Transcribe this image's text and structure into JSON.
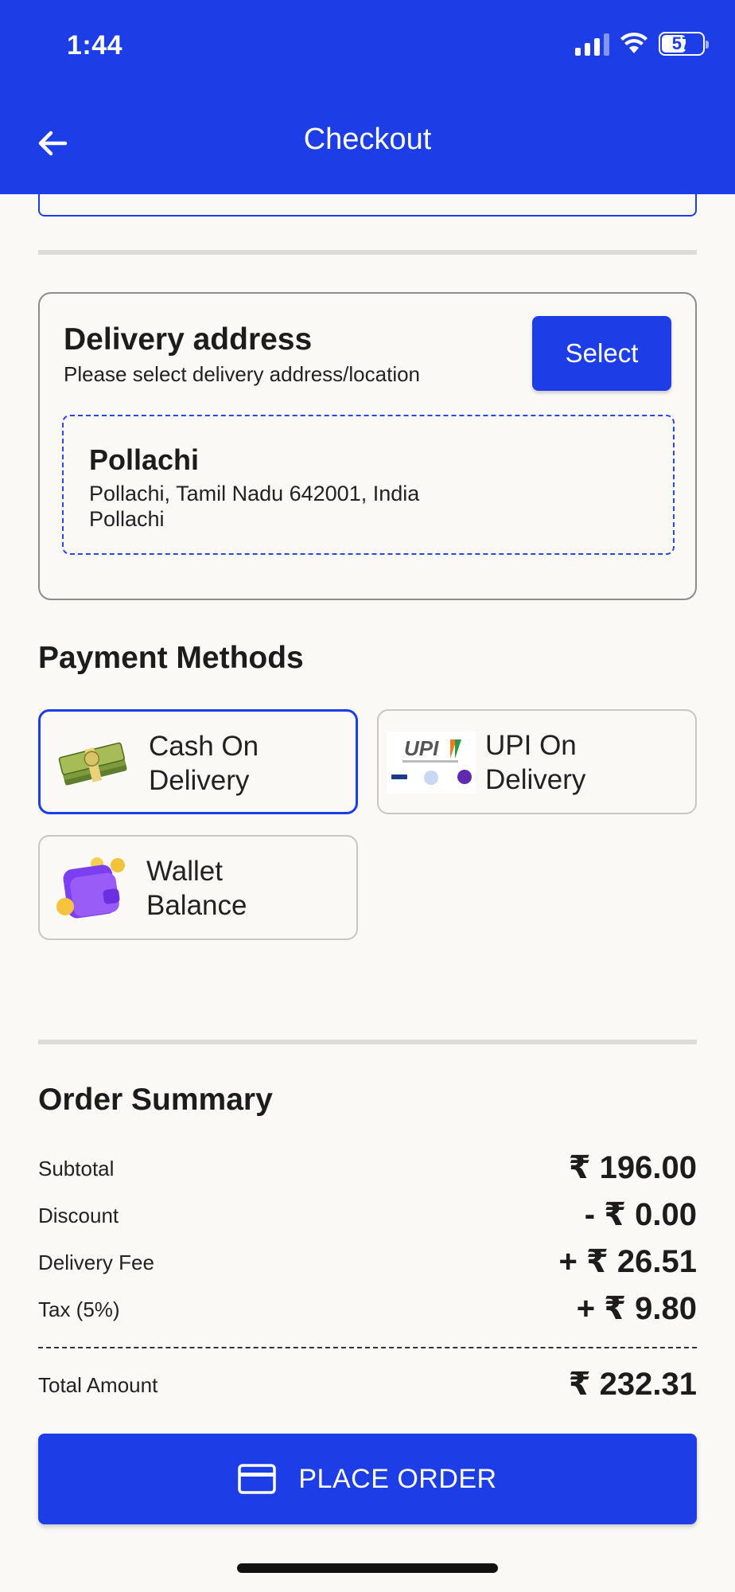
{
  "status_bar": {
    "time": "1:44",
    "battery": "57",
    "icons": [
      "signal-icon",
      "wifi-icon",
      "battery-icon"
    ]
  },
  "header": {
    "title": "Checkout",
    "back_icon": "arrow-left-icon",
    "background_color": "#1d3ee6"
  },
  "delivery": {
    "title": "Delivery address",
    "subtitle": "Please select delivery address/location",
    "select_label": "Select",
    "address": {
      "name": "Pollachi",
      "line1": "Pollachi, Tamil Nadu 642001, India",
      "line2": "Pollachi"
    }
  },
  "payment": {
    "title": "Payment Methods",
    "methods": [
      {
        "line1": "Cash On",
        "line2": "Delivery",
        "icon": "cash-icon",
        "selected": true
      },
      {
        "line1": "UPI On",
        "line2": "Delivery",
        "icon": "upi-icon",
        "selected": false
      },
      {
        "line1": "Wallet",
        "line2": "Balance",
        "icon": "wallet-icon",
        "selected": false
      }
    ],
    "upi_logo_text": "UPI"
  },
  "summary": {
    "title": "Order Summary",
    "rows": [
      {
        "label": "Subtotal",
        "value": "₹ 196.00"
      },
      {
        "label": "Discount",
        "value": "- ₹ 0.00"
      },
      {
        "label": "Delivery Fee",
        "value": "+ ₹ 26.51"
      },
      {
        "label": "Tax (5%)",
        "value": "+ ₹ 9.80"
      }
    ],
    "total_label": "Total Amount",
    "total_value": "₹ 232.31"
  },
  "place_order": {
    "label": "PLACE ORDER",
    "icon": "credit-card-icon"
  },
  "colors": {
    "accent": "#1d3ee6",
    "background": "#fbf9f6"
  }
}
